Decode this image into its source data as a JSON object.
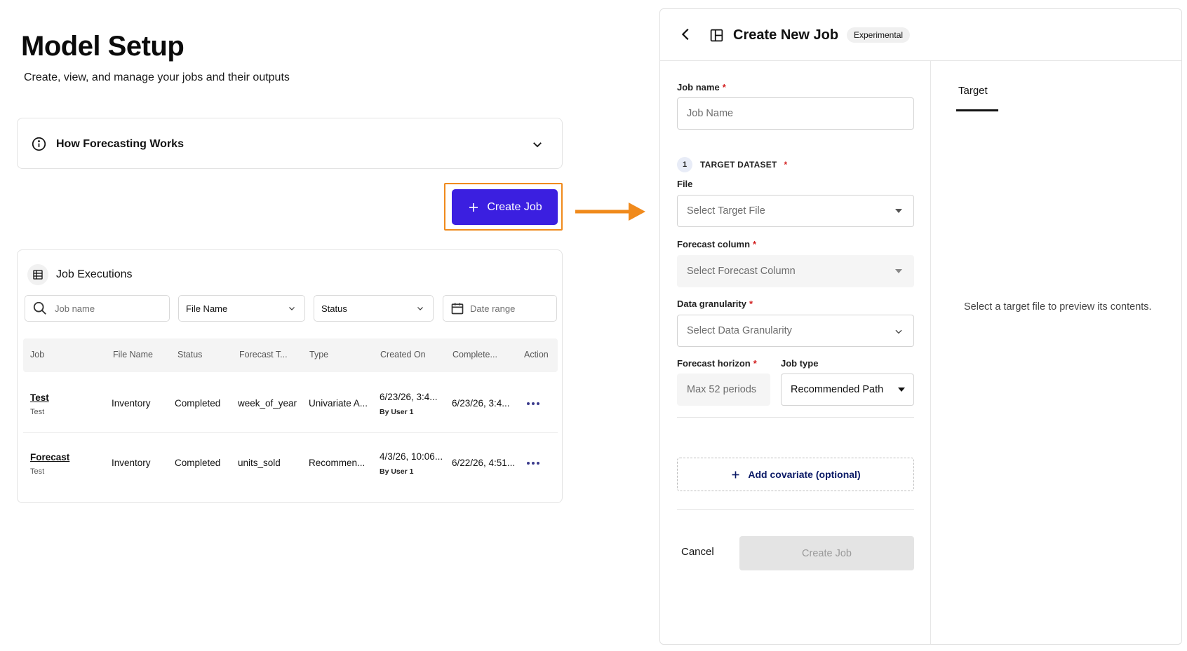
{
  "main": {
    "title": "Model Setup",
    "subtitle": "Create, view, and manage your jobs and their outputs",
    "accordion": {
      "label": "How Forecasting Works",
      "icon": "info-icon"
    },
    "create_button": {
      "label": "Create Job",
      "icon": "plus-icon",
      "highlight_color": "#f08a1c",
      "bg_color": "#3b1fe0"
    },
    "executions": {
      "title": "Job Executions",
      "filters": {
        "search_placeholder": "Job name",
        "file_name": "File Name",
        "status": "Status",
        "date_placeholder": "Date range"
      },
      "columns": [
        "Job",
        "File Name",
        "Status",
        "Forecast T...",
        "Type",
        "Created On",
        "Complete...",
        "Action"
      ],
      "rows": [
        {
          "job": "Test",
          "job_sub": "Test",
          "file": "Inventory",
          "status": "Completed",
          "forecast": "week_of_year",
          "type": "Univariate A...",
          "created": "6/23/26, 3:4...",
          "created_by": "By User 1",
          "completed": "6/23/26, 3:4..."
        },
        {
          "job": "Forecast",
          "job_sub": "Test",
          "file": "Inventory",
          "status": "Completed",
          "forecast": "units_sold",
          "type": "Recommen...",
          "created": "4/3/26, 10:06...",
          "created_by": "By User 1",
          "completed": "6/22/26, 4:51..."
        }
      ]
    }
  },
  "panel": {
    "title": "Create New Job",
    "badge": "Experimental",
    "form": {
      "job_name_label": "Job name",
      "job_name_placeholder": "Job Name",
      "step_number": "1",
      "step_label": "TARGET DATASET",
      "file_label": "File",
      "file_placeholder": "Select Target File",
      "forecast_col_label": "Forecast column",
      "forecast_col_placeholder": "Select Forecast Column",
      "granularity_label": "Data granularity",
      "granularity_placeholder": "Select Data Granularity",
      "horizon_label": "Forecast horizon",
      "horizon_placeholder": "Max 52 periods",
      "job_type_label": "Job type",
      "job_type_value": "Recommended Path",
      "covariate_label": "Add covariate (optional)",
      "cancel_label": "Cancel",
      "create_label": "Create Job",
      "required_mark": "*"
    },
    "preview": {
      "tab_label": "Target",
      "empty_message": "Select a target file to preview its contents."
    }
  }
}
